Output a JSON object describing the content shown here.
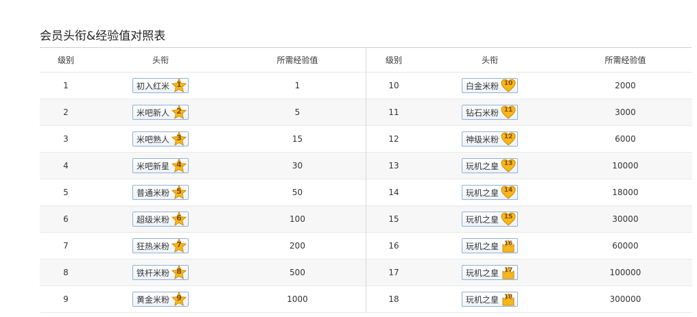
{
  "page_title": "会员头衔&经验值对照表",
  "headers": {
    "level": "级别",
    "title": "头衔",
    "exp": "所需经验值"
  },
  "colors": {
    "star_fill": "#f5b81c",
    "star_stroke": "#d48a00",
    "badge_border": "#8eb0d6",
    "number_text": "#8a4a00"
  },
  "left_rows": [
    {
      "level": "1",
      "title": "初入红米",
      "exp": "1",
      "icon": "star-icon",
      "num": "1"
    },
    {
      "level": "2",
      "title": "米吧新人",
      "exp": "5",
      "icon": "star-icon",
      "num": "2"
    },
    {
      "level": "3",
      "title": "米吧熟人",
      "exp": "15",
      "icon": "star-icon",
      "num": "3"
    },
    {
      "level": "4",
      "title": "米吧新星",
      "exp": "30",
      "icon": "star-icon",
      "num": "4"
    },
    {
      "level": "5",
      "title": "普通米粉",
      "exp": "50",
      "icon": "star-icon",
      "num": "5"
    },
    {
      "level": "6",
      "title": "超级米粉",
      "exp": "100",
      "icon": "star-icon",
      "num": "6"
    },
    {
      "level": "7",
      "title": "狂热米粉",
      "exp": "200",
      "icon": "star-icon",
      "num": "7"
    },
    {
      "level": "8",
      "title": "铁杆米粉",
      "exp": "500",
      "icon": "star-icon",
      "num": "8"
    },
    {
      "level": "9",
      "title": "黄金米粉",
      "exp": "1000",
      "icon": "star-icon",
      "num": "9"
    }
  ],
  "right_rows": [
    {
      "level": "10",
      "title": "白金米粉",
      "exp": "2000",
      "icon": "heart-icon",
      "num": "10"
    },
    {
      "level": "11",
      "title": "钻石米粉",
      "exp": "3000",
      "icon": "heart-icon",
      "num": "11"
    },
    {
      "level": "12",
      "title": "神级米粉",
      "exp": "6000",
      "icon": "heart-icon",
      "num": "12"
    },
    {
      "level": "13",
      "title": "玩机之皇",
      "exp": "10000",
      "icon": "heart-icon",
      "num": "13"
    },
    {
      "level": "14",
      "title": "玩机之皇",
      "exp": "18000",
      "icon": "heart-icon",
      "num": "14"
    },
    {
      "level": "15",
      "title": "玩机之皇",
      "exp": "30000",
      "icon": "heart-icon",
      "num": "15"
    },
    {
      "level": "16",
      "title": "玩机之皇",
      "exp": "60000",
      "icon": "crown-icon",
      "num": "16"
    },
    {
      "level": "17",
      "title": "玩机之皇",
      "exp": "100000",
      "icon": "crown-icon",
      "num": "17"
    },
    {
      "level": "18",
      "title": "玩机之皇",
      "exp": "300000",
      "icon": "crown-icon",
      "num": "18"
    }
  ]
}
